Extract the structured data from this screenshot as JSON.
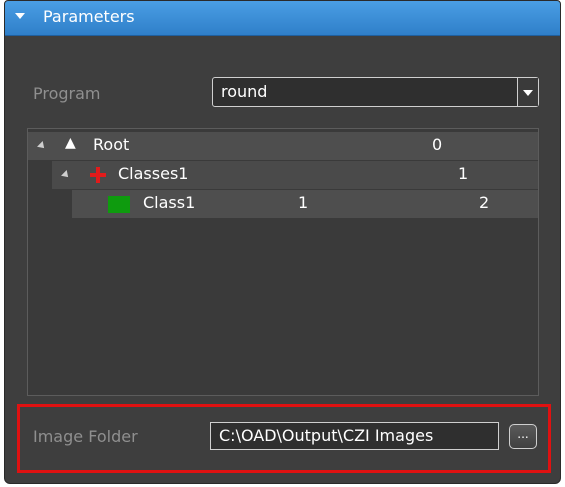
{
  "header": {
    "title": "Parameters",
    "expand_icon": "chevron-down-icon"
  },
  "program": {
    "label": "Program",
    "value": "round"
  },
  "tree": {
    "rows": [
      {
        "label": "Root",
        "col1": "",
        "col2": "0",
        "icon": "up-arrow-icon"
      },
      {
        "label": "Classes1",
        "col1": "",
        "col2": "1",
        "icon": "red-plus-icon"
      },
      {
        "label": "Class1",
        "col1": "1",
        "col2": "2",
        "icon": "green-swatch-icon",
        "color": "#0e9b0e"
      }
    ]
  },
  "image_folder": {
    "label": "Image Folder",
    "value": "C:\\OAD\\Output\\CZI Images",
    "browse_label": "..."
  },
  "colors": {
    "accent": "#2f7fc9",
    "highlight_border": "#e01111"
  }
}
